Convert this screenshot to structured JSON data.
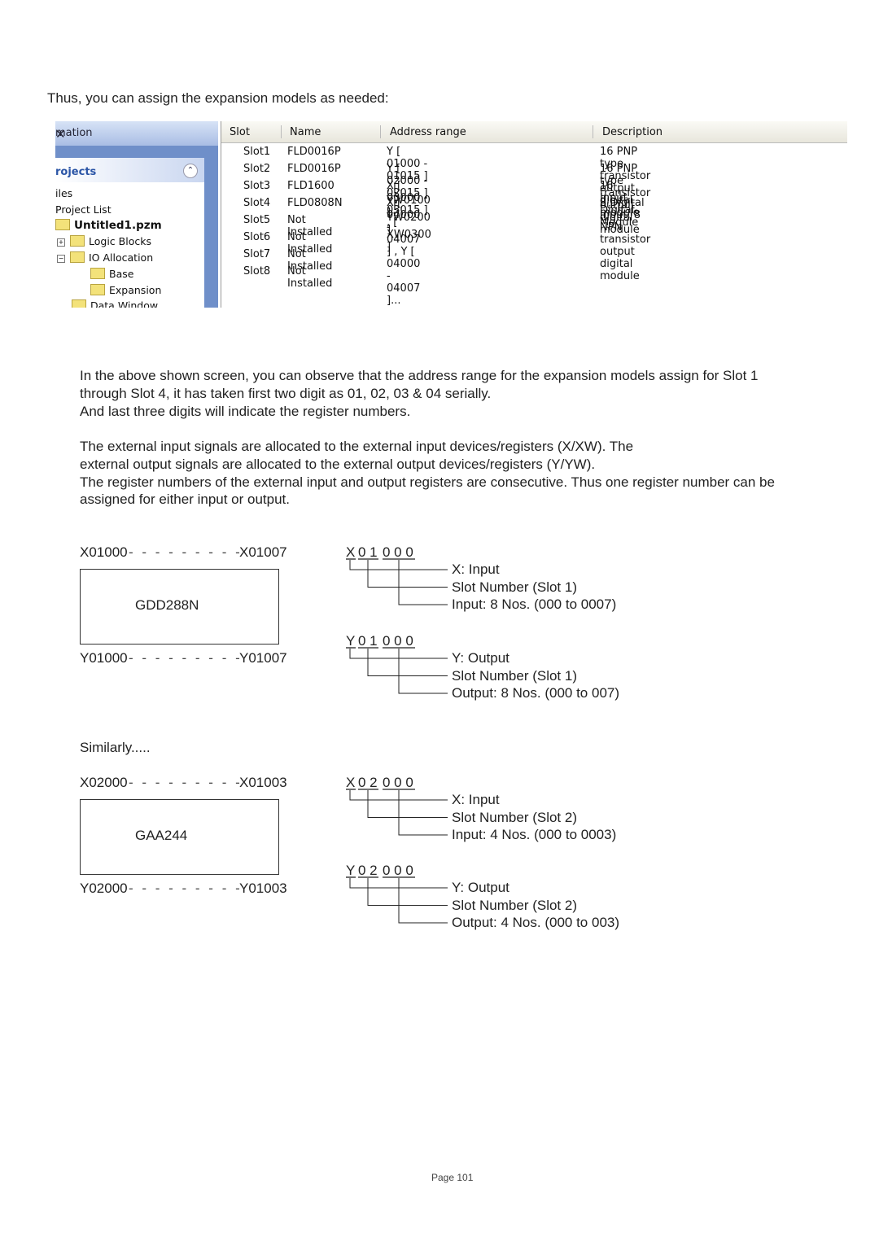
{
  "intro": "Thus, you can assign the expansion models as needed:",
  "screenshot": {
    "left_panel": {
      "title": "mation",
      "projects_title": "rojects",
      "items": [
        "iles",
        "Project List",
        "Untitled1.pzm",
        "Logic Blocks",
        "IO Allocation",
        "Base",
        "Expansion",
        "Data Window"
      ]
    },
    "columns": [
      "Slot",
      "Name",
      "Address range",
      "Description"
    ],
    "rows": [
      [
        "Slot1",
        "FLD0016P",
        "Y [ 01000 - 01015 ] , [ YW0100 ]",
        "16 PNP type transistor output digital module"
      ],
      [
        "Slot2",
        "FLD0016P",
        "Y [ 02000 - 02015 ] , [ YW0200 ]",
        "16 PNP type transistor output digital module"
      ],
      [
        "Slot3",
        "FLD1600",
        "X [ 03000 - 03015 ] , [ XW0300 ]",
        "16 Input Digital Module"
      ],
      [
        "Slot4",
        "FLD0808N",
        "X [ 04000 - 04007 ] , Y [ 04000 - 04007 ]...",
        "8 Digital input, 8 NPN transistor output digital module"
      ],
      [
        "Slot5",
        "Not Installed",
        "",
        ""
      ],
      [
        "Slot6",
        "Not Installed",
        "",
        ""
      ],
      [
        "Slot7",
        "Not Installed",
        "",
        ""
      ],
      [
        "Slot8",
        "Not Installed",
        "",
        ""
      ]
    ]
  },
  "paragraphs": [
    "In the above shown screen, you can observe that the address range for the expansion models assign for Slot 1",
    "through Slot 4, it has taken first two digit as 01, 02, 03 & 04 serially.",
    "And last three digits will indicate the register numbers.",
    "The external input signals are allocated to the external input devices/registers (X/XW). The",
    "external output signals are allocated to the external output devices/registers (Y/YW).",
    "The register numbers of the external input and output registers are consecutive. Thus one register number can be",
    "assigned for either input or output."
  ],
  "modules": [
    {
      "top_left": "X01000",
      "top_right": "X01007",
      "name": "GDD288N",
      "bottom_left": "Y01000",
      "bottom_right": "Y01007"
    },
    {
      "top_left": "X02000",
      "top_right": "X01003",
      "name": "GAA244",
      "bottom_left": "Y02000",
      "bottom_right": "Y01003"
    }
  ],
  "similarly": "Similarly.....",
  "codes": [
    {
      "code": [
        "X",
        "0 1",
        "0 0 0"
      ],
      "labels": [
        "X: Input",
        "Slot Number (Slot 1)",
        "Input: 8 Nos. (000 to 0007)"
      ]
    },
    {
      "code": [
        "Y",
        "0 1",
        "0 0 0"
      ],
      "labels": [
        "Y: Output",
        "Slot Number (Slot 1)",
        "Output: 8 Nos. (000 to 007)"
      ]
    },
    {
      "code": [
        "X",
        "0 2",
        "0 0 0"
      ],
      "labels": [
        "X: Input",
        "Slot Number (Slot 2)",
        "Input: 4 Nos. (000 to 0003)"
      ]
    },
    {
      "code": [
        "Y",
        "0 2",
        "0 0 0"
      ],
      "labels": [
        "Y: Output",
        "Slot Number (Slot 2)",
        "Output: 4 Nos. (000 to 003)"
      ]
    }
  ],
  "footer": "Page 101"
}
